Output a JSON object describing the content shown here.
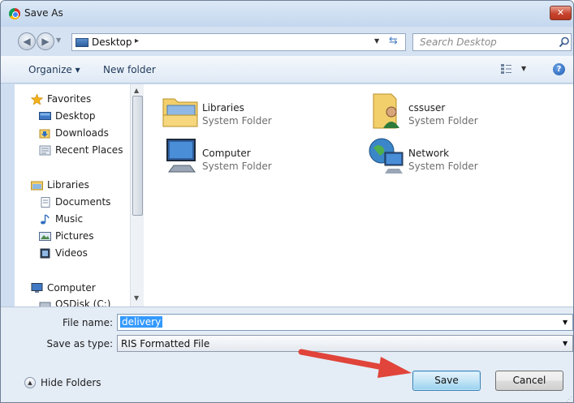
{
  "window": {
    "title": "Save As",
    "close_glyph": "✕"
  },
  "address": {
    "location": "Desktop",
    "crumb_separator": "▸",
    "search_placeholder": "Search Desktop"
  },
  "toolbar": {
    "organize": "Organize ▾",
    "new_folder": "New folder",
    "help_glyph": "?"
  },
  "sidebar": {
    "items": [
      {
        "label": "Favorites",
        "icon": "star-icon"
      },
      {
        "label": "Desktop",
        "icon": "desktop-icon"
      },
      {
        "label": "Downloads",
        "icon": "downloads-icon"
      },
      {
        "label": "Recent Places",
        "icon": "recent-places-icon"
      },
      {
        "label": "Libraries",
        "icon": "libraries-icon"
      },
      {
        "label": "Documents",
        "icon": "documents-icon"
      },
      {
        "label": "Music",
        "icon": "music-icon"
      },
      {
        "label": "Pictures",
        "icon": "pictures-icon"
      },
      {
        "label": "Videos",
        "icon": "videos-icon"
      },
      {
        "label": "Computer",
        "icon": "computer-icon"
      },
      {
        "label": "OSDisk (C:)",
        "icon": "drive-icon"
      }
    ]
  },
  "content": {
    "items": [
      {
        "name": "Libraries",
        "type": "System Folder",
        "icon": "libraries-folder-icon"
      },
      {
        "name": "cssuser",
        "type": "System Folder",
        "icon": "user-folder-icon"
      },
      {
        "name": "Computer",
        "type": "System Folder",
        "icon": "computer-icon"
      },
      {
        "name": "Network",
        "type": "System Folder",
        "icon": "network-icon"
      }
    ]
  },
  "form": {
    "file_name_label": "File name:",
    "file_name_value": "delivery",
    "save_as_type_label": "Save as type:",
    "save_as_type_value": "RIS Formatted File"
  },
  "buttons": {
    "hide_folders": "Hide Folders",
    "save": "Save",
    "cancel": "Cancel"
  },
  "colors": {
    "arrow": "#e0443a",
    "selection": "#3399ff"
  }
}
